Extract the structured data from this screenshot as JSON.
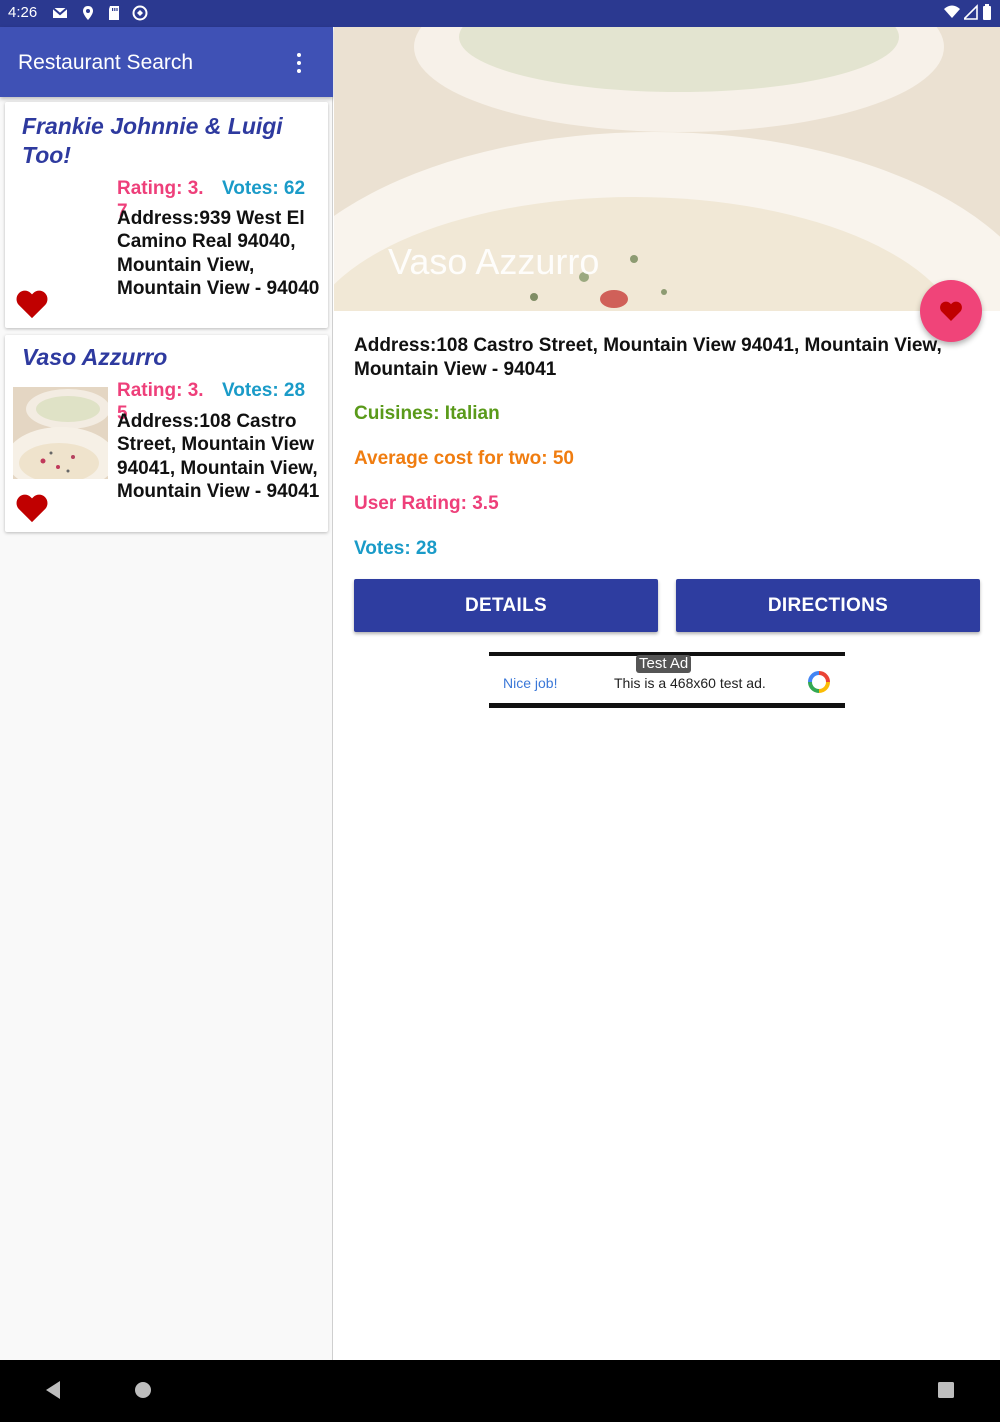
{
  "status_bar": {
    "time": "4:26",
    "icons_left": [
      "gmail-icon",
      "location-icon",
      "sd-card-icon",
      "sync-icon"
    ],
    "icons_right": [
      "wifi-icon",
      "signal-icon",
      "battery-icon"
    ]
  },
  "app_bar": {
    "title": "Restaurant Search",
    "menu_icon": "more-vert-icon"
  },
  "restaurants": [
    {
      "name": "Frankie Johnnie & Luigi Too!",
      "rating": "Rating: 3.7",
      "votes": "Votes: 62",
      "address": "Address:939 West El Camino Real 94040, Mountain View, Mountain View - 94040",
      "favorite_icon": "heart-icon"
    },
    {
      "name": "Vaso Azzurro",
      "rating": "Rating: 3.5",
      "votes": "Votes: 28",
      "address": "Address:108 Castro Street, Mountain View 94041, Mountain View, Mountain View - 94041",
      "favorite_icon": "heart-icon"
    }
  ],
  "detail": {
    "title": "Vaso Azzurro",
    "address": "Address:108 Castro Street, Mountain View 94041, Mountain View, Mountain View - 94041",
    "cuisines": "Cuisines: Italian",
    "average_cost": "Average cost for two: 50",
    "user_rating": "User Rating: 3.5",
    "votes": "Votes: 28",
    "details_button": "DETAILS",
    "directions_button": "DIRECTIONS"
  },
  "ad": {
    "badge": "Test Ad",
    "nice": "Nice job!",
    "text": "This is a 468x60 test ad."
  },
  "colors": {
    "primary": "#3f51b5",
    "primary_dark": "#2b3990",
    "button": "#2e3da0",
    "accent": "#f04479",
    "heart": "#c00000",
    "rating": "#ee3f7a",
    "votes": "#1a9bc8",
    "cuisines": "#5a9a1a",
    "cost": "#f07d10"
  }
}
